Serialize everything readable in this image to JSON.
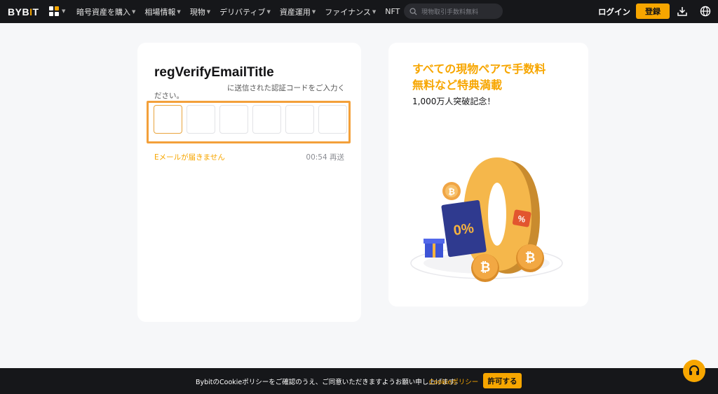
{
  "header": {
    "logo_text": "BYB",
    "logo_accent": "I",
    "logo_tail": "T",
    "nav": [
      {
        "label": "暗号資産を購入"
      },
      {
        "label": "相場情報"
      },
      {
        "label": "現物"
      },
      {
        "label": "デリバティブ"
      },
      {
        "label": "資産運用"
      },
      {
        "label": "ファイナンス"
      },
      {
        "label": "NFT"
      }
    ],
    "search_placeholder": "現物取引手数料無料",
    "login_label": "ログイン",
    "register_label": "登録",
    "icons": [
      "apps-grid-icon",
      "search-icon",
      "download-icon",
      "globe-icon"
    ]
  },
  "verify": {
    "title": "regVerifyEmailTitle",
    "subtitle_line1": "に送信された認証コードをご入力く",
    "subtitle_line2": "ださい。",
    "code_boxes": [
      "",
      "",
      "",
      "",
      "",
      ""
    ],
    "no_email_link": "Eメールが届きません",
    "timer": "00:54 再送"
  },
  "promo": {
    "title_line1": "すべての現物ペアで手数料",
    "title_line2": "無料など特典満載",
    "subtitle": "1,000万人突破記念！",
    "ticket_text": "0%",
    "bubble_text": "%"
  },
  "cookie": {
    "text": "BybitのCookieポリシーをご確認のうえ、ご同意いただきますようお願い申し上げます。",
    "link": "Cookieポリシー",
    "allow_label": "許可する"
  },
  "colors": {
    "brand": "#f7a600",
    "topbar": "#16171a",
    "page_bg": "#f6f7f9",
    "annotation_highlight": "#f3a03a"
  }
}
